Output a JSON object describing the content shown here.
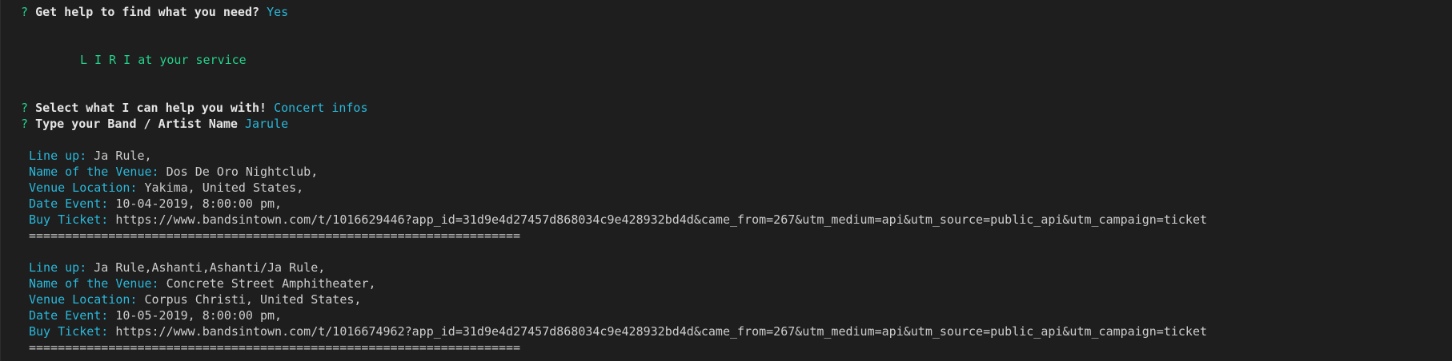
{
  "prompts": {
    "help": {
      "mark": "?",
      "question": "Get help to find what you need?",
      "answer": "Yes"
    },
    "service_banner": "L I R I at your service",
    "select": {
      "mark": "?",
      "question": "Select what I can help you with!",
      "answer": "Concert infos"
    },
    "artist": {
      "mark": "?",
      "question": "Type your Band / Artist Name",
      "answer": "Jarule"
    }
  },
  "labels": {
    "lineup": "Line up:",
    "venue": "Name of the Venue:",
    "location": "Venue Location:",
    "date": "Date Event:",
    "ticket": "Buy Ticket:"
  },
  "separator": "====================================================================",
  "events": [
    {
      "lineup": "Ja Rule,",
      "venue": "Dos De Oro Nightclub,",
      "location": "Yakima, United States,",
      "date": "10-04-2019, 8:00:00 pm,",
      "ticket": "https://www.bandsintown.com/t/1016629446?app_id=31d9e4d27457d868034c9e428932bd4d&came_from=267&utm_medium=api&utm_source=public_api&utm_campaign=ticket"
    },
    {
      "lineup": "Ja Rule,Ashanti,Ashanti/Ja Rule,",
      "venue": "Concrete Street Amphitheater,",
      "location": "Corpus Christi, United States,",
      "date": "10-05-2019, 8:00:00 pm,",
      "ticket": "https://www.bandsintown.com/t/1016674962?app_id=31d9e4d27457d868034c9e428932bd4d&came_from=267&utm_medium=api&utm_source=public_api&utm_campaign=ticket"
    }
  ]
}
